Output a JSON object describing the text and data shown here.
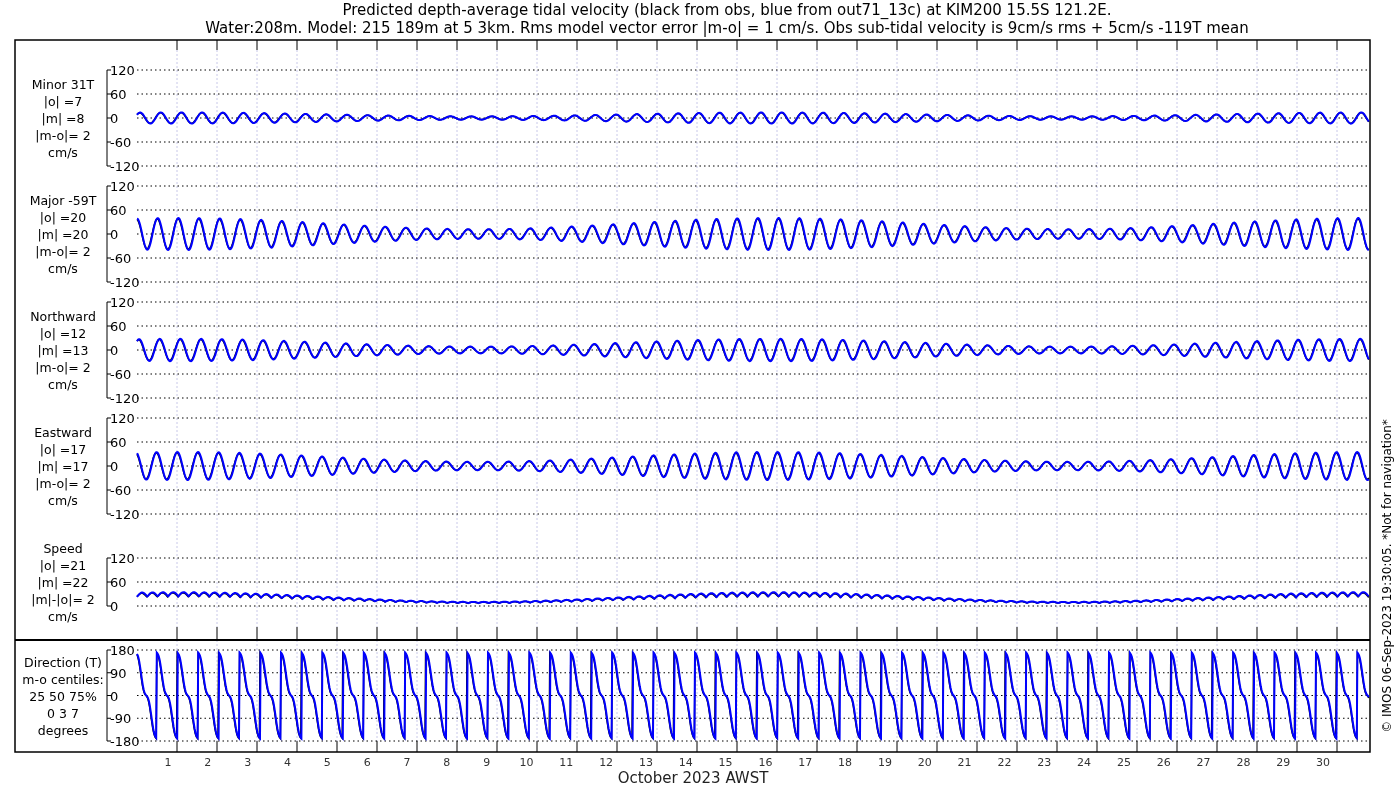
{
  "title_lines": [
    "Predicted depth-average tidal velocity (black from obs, blue from out71_13c) at KIM200 15.5S 121.2E.",
    "Water:208m. Model: 215 189m at 5 3km. Rms model vector error |m-o| = 1 cm/s. Obs sub-tidal velocity is 9cm/s rms + 5cm/s -119T mean"
  ],
  "panels": [
    {
      "kind": "velocity",
      "label_lines": [
        "Minor 31T",
        "|o| =7",
        "|m| =8",
        "|m-o|= 2",
        "cm/s"
      ],
      "yticks": [
        "120",
        "60",
        "0",
        "-60",
        "-120"
      ]
    },
    {
      "kind": "velocity",
      "label_lines": [
        "Major -59T",
        "|o| =20",
        "|m| =20",
        "|m-o|= 2",
        "cm/s"
      ],
      "yticks": [
        "120",
        "60",
        "0",
        "-60",
        "-120"
      ]
    },
    {
      "kind": "velocity",
      "label_lines": [
        "Northward",
        "|o| =12",
        "|m| =13",
        "|m-o|= 2",
        "cm/s"
      ],
      "yticks": [
        "120",
        "60",
        "0",
        "-60",
        "-120"
      ]
    },
    {
      "kind": "velocity",
      "label_lines": [
        "Eastward",
        "|o| =17",
        "|m| =17",
        "|m-o|= 2",
        "cm/s"
      ],
      "yticks": [
        "120",
        "60",
        "0",
        "-60",
        "-120"
      ]
    },
    {
      "kind": "speed",
      "label_lines": [
        "Speed",
        "|o| =21",
        "|m| =22",
        "|m|-|o|= 2",
        "cm/s"
      ],
      "yticks": [
        "120",
        "60",
        "0"
      ]
    },
    {
      "kind": "direction",
      "label_lines": [
        "Direction (T)",
        "m-o centiles:",
        "25  50  75%",
        "0  3  7",
        "degrees"
      ],
      "yticks": [
        "180",
        "90",
        "0",
        "-90",
        "-180"
      ]
    }
  ],
  "x_axis": {
    "day_labels": [
      "1",
      "2",
      "3",
      "4",
      "5",
      "6",
      "7",
      "8",
      "9",
      "10",
      "11",
      "12",
      "13",
      "14",
      "15",
      "16",
      "17",
      "18",
      "19",
      "20",
      "21",
      "22",
      "23",
      "24",
      "25",
      "26",
      "27",
      "28",
      "29",
      "30"
    ],
    "title": "October 2023 AWST"
  },
  "footer_note": "© IMOS 06-Sep-2023 19:30:05. *Not for navigation*"
}
